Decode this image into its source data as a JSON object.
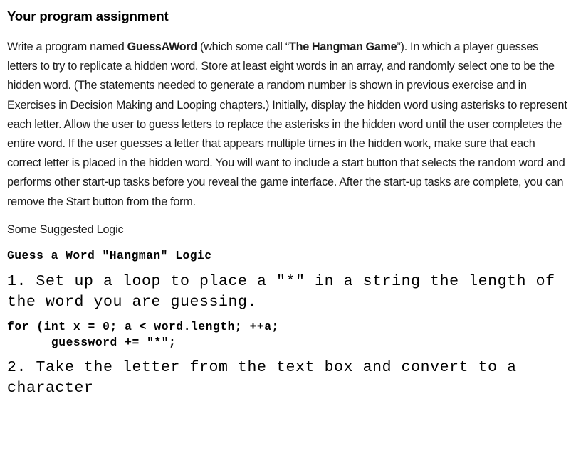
{
  "document": {
    "title": "Your program assignment",
    "assignment_paragraph": {
      "segments": [
        {
          "type": "text",
          "value": "Write a program named "
        },
        {
          "type": "bold",
          "value": "GuessAWord"
        },
        {
          "type": "text",
          "value": " (which some call “"
        },
        {
          "type": "bold",
          "value": "The Hangman Game"
        },
        {
          "type": "text",
          "value": "”). In which a player guesses letters to try to replicate a hidden word. Store at least eight words in an array, and randomly select one to be the hidden word. (The statements needed to generate a random number is shown in previous exercise and in Exercises in Decision Making and Looping chapters.) Initially, display the hidden word using asterisks to represent each letter. Allow the user to guess letters to replace the asterisks in the hidden word until the user completes the entire word. If the user guesses a letter that appears multiple times in the hidden work, make sure that each correct letter is placed in the hidden word. You will want to include a start button that selects the random word and performs other start-up tasks before you reveal the game interface. After the start-up tasks are complete, you can remove the Start button from the form."
        }
      ]
    },
    "suggested_logic_label": "Some Suggested Logic",
    "logic_title": "Guess a Word \"Hangman\" Logic",
    "step_1": "1. Set up a loop to place a \"*\" in a string the length of the word you are guessing.",
    "code_block_1": "for (int x = 0; a < word.length; ++a;\n      guessword += \"*\";",
    "step_2": "2. Take the letter from the text box and convert to a character"
  },
  "colors": {
    "page_background": "#ffffff",
    "body_text": "#1c1c1c",
    "heading_text": "#000000",
    "code_text": "#000000"
  }
}
